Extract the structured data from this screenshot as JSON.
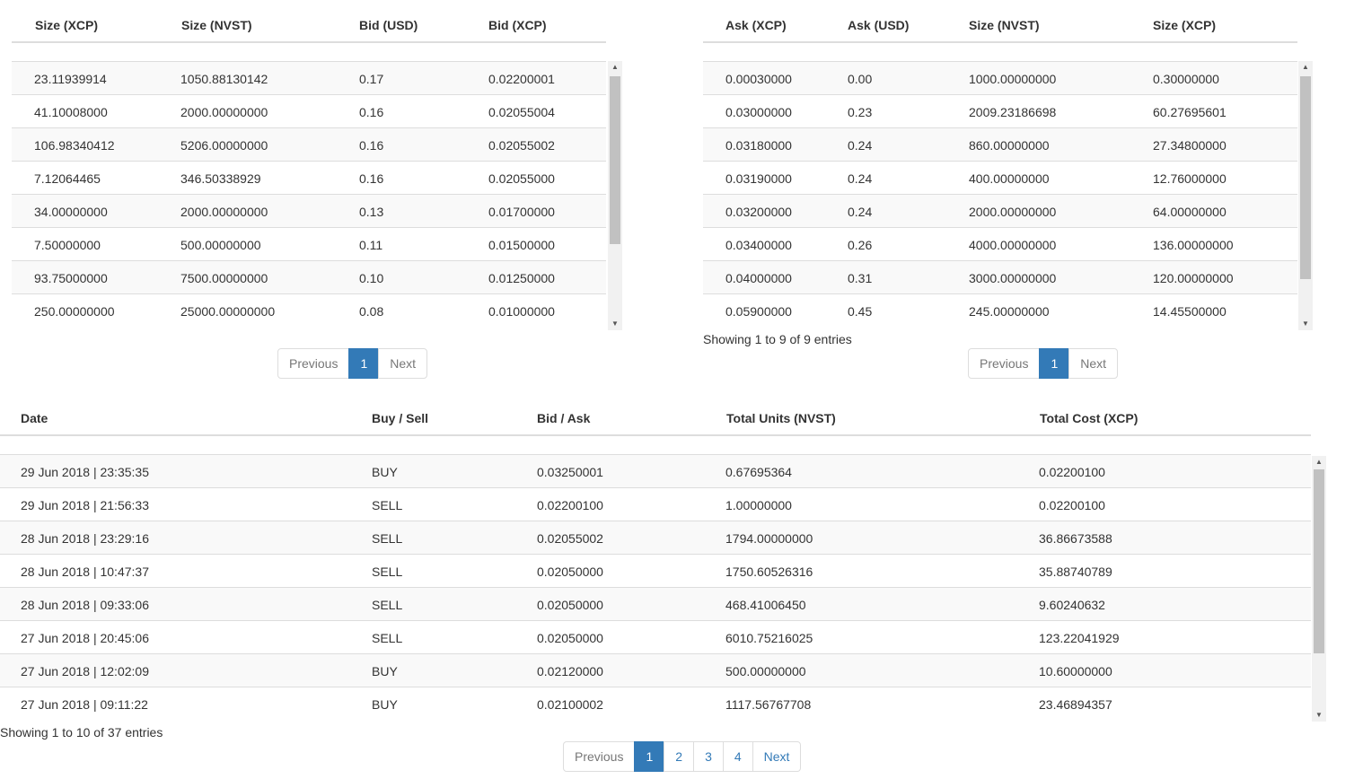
{
  "bids": {
    "columns": [
      "Size (XCP)",
      "Size (NVST)",
      "Bid (USD)",
      "Bid (XCP)"
    ],
    "rows": [
      [
        "23.11939914",
        "1050.88130142",
        "0.17",
        "0.02200001"
      ],
      [
        "41.10008000",
        "2000.00000000",
        "0.16",
        "0.02055004"
      ],
      [
        "106.98340412",
        "5206.00000000",
        "0.16",
        "0.02055002"
      ],
      [
        "7.12064465",
        "346.50338929",
        "0.16",
        "0.02055000"
      ],
      [
        "34.00000000",
        "2000.00000000",
        "0.13",
        "0.01700000"
      ],
      [
        "7.50000000",
        "500.00000000",
        "0.11",
        "0.01500000"
      ],
      [
        "93.75000000",
        "7500.00000000",
        "0.10",
        "0.01250000"
      ],
      [
        "250.00000000",
        "25000.00000000",
        "0.08",
        "0.01000000"
      ]
    ],
    "pager": {
      "previous": "Previous",
      "pages": [
        "1"
      ],
      "active": "1",
      "next": "Next"
    }
  },
  "asks": {
    "columns": [
      "Ask (XCP)",
      "Ask (USD)",
      "Size (NVST)",
      "Size (XCP)"
    ],
    "rows": [
      [
        "0.00030000",
        "0.00",
        "1000.00000000",
        "0.30000000"
      ],
      [
        "0.03000000",
        "0.23",
        "2009.23186698",
        "60.27695601"
      ],
      [
        "0.03180000",
        "0.24",
        "860.00000000",
        "27.34800000"
      ],
      [
        "0.03190000",
        "0.24",
        "400.00000000",
        "12.76000000"
      ],
      [
        "0.03200000",
        "0.24",
        "2000.00000000",
        "64.00000000"
      ],
      [
        "0.03400000",
        "0.26",
        "4000.00000000",
        "136.00000000"
      ],
      [
        "0.04000000",
        "0.31",
        "3000.00000000",
        "120.00000000"
      ],
      [
        "0.05900000",
        "0.45",
        "245.00000000",
        "14.45500000"
      ]
    ],
    "info": "Showing 1 to 9 of 9 entries",
    "pager": {
      "previous": "Previous",
      "pages": [
        "1"
      ],
      "active": "1",
      "next": "Next"
    }
  },
  "trades": {
    "columns": [
      "Date",
      "Buy / Sell",
      "Bid / Ask",
      "Total Units (NVST)",
      "Total Cost (XCP)"
    ],
    "rows": [
      [
        "29 Jun 2018 | 23:35:35",
        "BUY",
        "0.03250001",
        "0.67695364",
        "0.02200100"
      ],
      [
        "29 Jun 2018 | 21:56:33",
        "SELL",
        "0.02200100",
        "1.00000000",
        "0.02200100"
      ],
      [
        "28 Jun 2018 | 23:29:16",
        "SELL",
        "0.02055002",
        "1794.00000000",
        "36.86673588"
      ],
      [
        "28 Jun 2018 | 10:47:37",
        "SELL",
        "0.02050000",
        "1750.60526316",
        "35.88740789"
      ],
      [
        "28 Jun 2018 | 09:33:06",
        "SELL",
        "0.02050000",
        "468.41006450",
        "9.60240632"
      ],
      [
        "27 Jun 2018 | 20:45:06",
        "SELL",
        "0.02050000",
        "6010.75216025",
        "123.22041929"
      ],
      [
        "27 Jun 2018 | 12:02:09",
        "BUY",
        "0.02120000",
        "500.00000000",
        "10.60000000"
      ],
      [
        "27 Jun 2018 | 09:11:22",
        "BUY",
        "0.02100002",
        "1117.56767708",
        "23.46894357"
      ]
    ],
    "info": "Showing 1 to 10 of 37 entries",
    "pager": {
      "previous": "Previous",
      "pages": [
        "1",
        "2",
        "3",
        "4"
      ],
      "active": "1",
      "next": "Next"
    }
  },
  "colors": {
    "accent": "#337ab7",
    "border": "#dddddd",
    "stripe": "#f9f9f9"
  },
  "icons": {
    "scroll_up": "triangle-up-icon",
    "scroll_down": "triangle-down-icon"
  }
}
